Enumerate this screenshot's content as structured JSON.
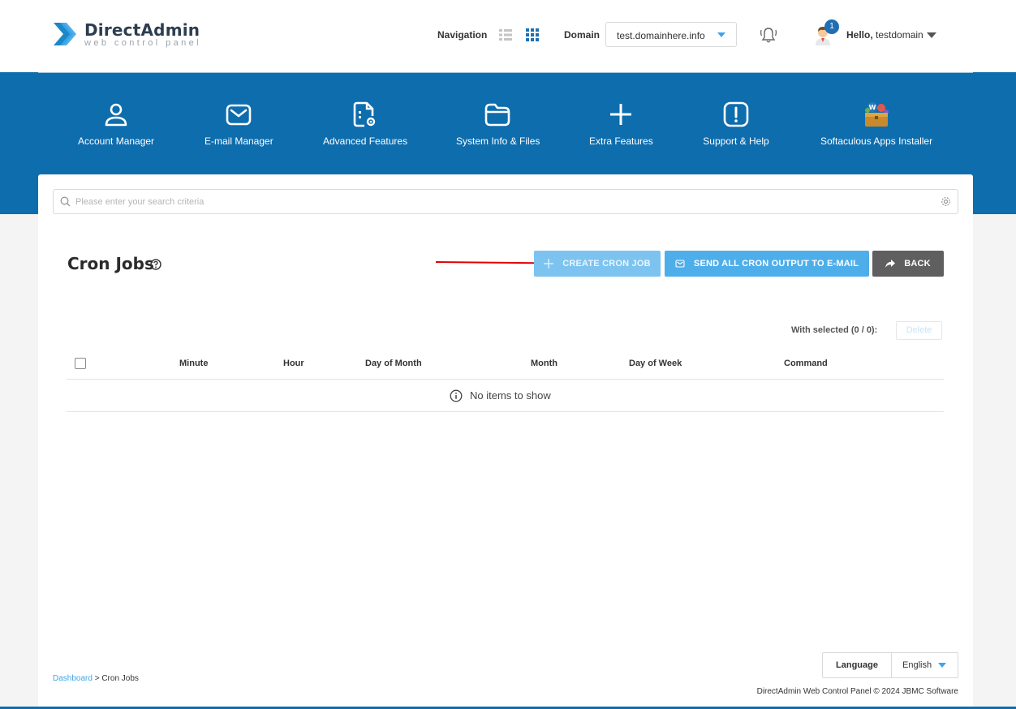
{
  "header": {
    "logo_title": "DirectAdmin",
    "logo_subtitle": "web control panel",
    "navigation_label": "Navigation",
    "domain_label": "Domain",
    "domain_value": "test.domainhere.info",
    "notification_count": "1",
    "hello_label": "Hello,",
    "username": "testdomain"
  },
  "menu": {
    "items": [
      {
        "label": "Account Manager",
        "icon": "user-icon"
      },
      {
        "label": "E-mail Manager",
        "icon": "envelope-icon"
      },
      {
        "label": "Advanced Features",
        "icon": "document-gear-icon"
      },
      {
        "label": "System Info & Files",
        "icon": "folder-icon"
      },
      {
        "label": "Extra Features",
        "icon": "plus-icon"
      },
      {
        "label": "Support & Help",
        "icon": "exclamation-icon"
      },
      {
        "label": "Softaculous Apps Installer",
        "icon": "softaculous-box-icon"
      }
    ]
  },
  "search": {
    "placeholder": "Please enter your search criteria"
  },
  "page": {
    "title": "Cron Jobs",
    "buttons": {
      "create": "CREATE CRON JOB",
      "send_all": "SEND ALL CRON OUTPUT TO E-MAIL",
      "back": "BACK"
    },
    "with_selected": "With selected (0 / 0):",
    "delete": "Delete"
  },
  "table": {
    "columns": [
      "Minute",
      "Hour",
      "Day of Month",
      "Month",
      "Day of Week",
      "Command"
    ],
    "empty_text": "No items to show"
  },
  "footer": {
    "language_label": "Language",
    "language_value": "English",
    "breadcrumb_link": "Dashboard",
    "breadcrumb_separator": ">",
    "breadcrumb_current": "Cron Jobs",
    "copyright": "DirectAdmin Web Control Panel © 2024 JBMC Software"
  },
  "colors": {
    "brand_blue": "#0e6dad",
    "accent_blue": "#3ea5e9",
    "annotation_arrow": "#e00000"
  }
}
